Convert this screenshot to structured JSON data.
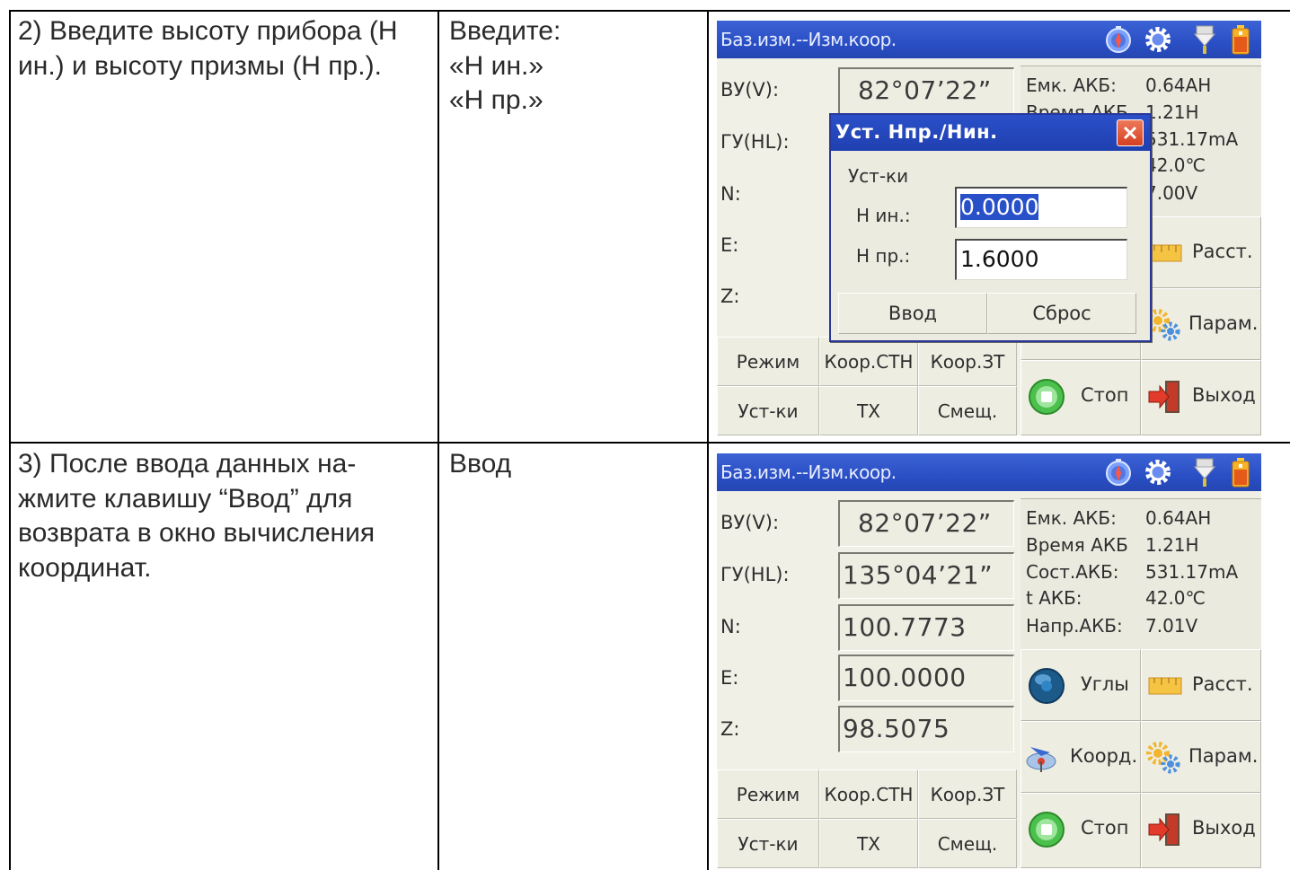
{
  "rows": [
    {
      "step_lines": [
        "2) Введите высоту прибора (Н",
        "ин.) и высоту призмы (Н пр.)."
      ],
      "action_lines": [
        "Введите:",
        "«Н ин.»",
        "«Н пр.»"
      ]
    },
    {
      "step_lines": [
        "3) После ввода данных на-",
        "жмите клавишу “Ввод” для",
        "возврата в окно вычисления",
        "координат."
      ],
      "action_lines": [
        "Ввод"
      ]
    }
  ],
  "screen1": {
    "title": "Баз.изм.--Изм.коор.",
    "title_icons": [
      "compass-icon",
      "gear-icon",
      "prism-icon",
      "battery-icon"
    ],
    "labels": [
      "ВУ(V):",
      "ГУ(HL):",
      "N:",
      "E:",
      "Z:"
    ],
    "values": [
      "82°07’22”",
      "",
      "",
      "",
      ""
    ],
    "info_keys": [
      "Емк. АКБ:",
      "Время АКБ",
      "",
      "",
      ""
    ],
    "info_values": [
      "0.64AH",
      "1.21H",
      "531.17mA",
      "42.0℃",
      "7.00V"
    ],
    "grid_buttons": [
      "Режим",
      "Коор.СТН",
      "Коор.ЗТ",
      "Уст-ки",
      "ТХ",
      "Смещ."
    ],
    "big_buttons": [
      {
        "label": "Расст.",
        "icon": "ruler-icon"
      },
      {
        "label": "Парам.",
        "icon": "settings-gears-icon"
      },
      {
        "label": "Стоп",
        "icon": "stop-icon"
      },
      {
        "label": "Выход",
        "icon": "exit-icon"
      }
    ],
    "dialog": {
      "title": "Уст. Нпр./Нин.",
      "group_label": "Уст-ки",
      "field1_label": "Н ин.:",
      "field1_value": "0.0000",
      "field2_label": "Н пр.:",
      "field2_value": "1.6000",
      "ok_label": "Ввод",
      "reset_label": "Сброс"
    }
  },
  "screen2": {
    "title": "Баз.изм.--Изм.коор.",
    "title_icons": [
      "compass-icon",
      "gear-icon",
      "prism-icon",
      "battery-icon"
    ],
    "labels": [
      "ВУ(V):",
      "ГУ(HL):",
      "N:",
      "E:",
      "Z:"
    ],
    "values": [
      "82°07’22”",
      "135°04’21”",
      "100.7773",
      "100.0000",
      "98.5075"
    ],
    "info_keys": [
      "Емк. АКБ:",
      "Время АКБ",
      "Сост.АКБ:",
      "t АКБ:",
      "Напр.АКБ:"
    ],
    "info_values": [
      "0.64AH",
      "1.21H",
      "531.17mA",
      "42.0℃",
      "7.01V"
    ],
    "grid_buttons": [
      "Режим",
      "Коор.СТН",
      "Коор.ЗТ",
      "Уст-ки",
      "ТХ",
      "Смещ."
    ],
    "big_buttons": [
      {
        "label": "Углы",
        "icon": "globe-icon"
      },
      {
        "label": "Расст.",
        "icon": "ruler-icon"
      },
      {
        "label": "Коорд.",
        "icon": "coordinates-icon"
      },
      {
        "label": "Парам.",
        "icon": "settings-gears-icon"
      },
      {
        "label": "Стоп",
        "icon": "stop-icon"
      },
      {
        "label": "Выход",
        "icon": "exit-icon"
      }
    ]
  }
}
